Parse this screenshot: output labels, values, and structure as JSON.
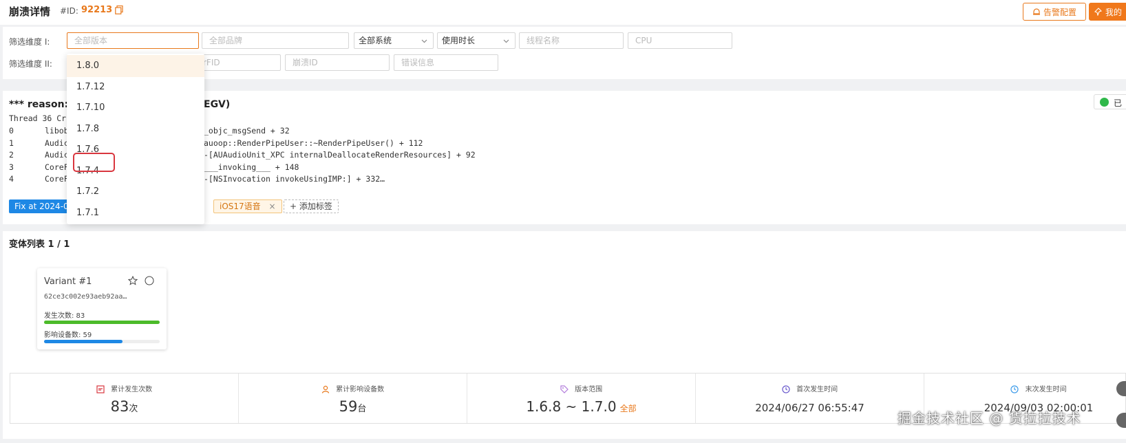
{
  "header": {
    "title": "崩溃详情",
    "id_label": "#ID:",
    "id_value": "92213",
    "alert_button": "告警配置",
    "mine_button": "我的"
  },
  "filters": {
    "row1_label": "筛选维度 I:",
    "row2_label": "筛选维度 II:",
    "version_placeholder": "全部版本",
    "brand_placeholder": "全部品牌",
    "system_value": "全部系统",
    "duration_value": "使用时长",
    "thread_placeholder": "线程名称",
    "cpu_placeholder": "CPU",
    "userfid_placeholder": "rFID",
    "crash_id_placeholder": "崩溃ID",
    "error_placeholder": "错误信息"
  },
  "version_dropdown": {
    "options": [
      "1.8.0",
      "1.7.12",
      "1.7.10",
      "1.7.8",
      "1.7.6",
      "1.7.4",
      "1.7.2",
      "1.7.1"
    ]
  },
  "reason": {
    "title": "*** reason:",
    "title_tail": "EGV)",
    "status_label": "已",
    "thread_header": "Thread 36 Cr",
    "frames": [
      {
        "idx": "0",
        "lib": "libob",
        "symbol": "_objc_msgSend + 32"
      },
      {
        "idx": "1",
        "lib": "Audic",
        "symbol": "auoop::RenderPipeUser::~RenderPipeUser() + 112"
      },
      {
        "idx": "2",
        "lib": "Audic",
        "symbol": "-[AUAudioUnit_XPC internalDeallocateRenderResources] + 92"
      },
      {
        "idx": "3",
        "lib": "CoreF",
        "symbol": "___invoking___ + 148"
      },
      {
        "idx": "4",
        "lib": "CoreF",
        "symbol": "-[NSInvocation invokeUsingIMP:] + 332…"
      }
    ],
    "tags": {
      "fix": "Fix at 2024-0",
      "ios": "iOS17语音",
      "add": "添加标签"
    }
  },
  "variants": {
    "title": "变体列表 1 / 1",
    "cards": [
      {
        "name": "Variant #1",
        "hash": "62ce3c002e93aeb92aa…",
        "occurrences_label": "发生次数: 83",
        "devices_label": "影响设备数: 59",
        "occurrences_fill": 1.0,
        "devices_fill": 0.68
      }
    ]
  },
  "stats": {
    "total_count_label": "累计发生次数",
    "total_count_value": "83",
    "total_count_unit": "次",
    "devices_label": "累计影响设备数",
    "devices_value": "59",
    "devices_unit": "台",
    "version_label": "版本范围",
    "version_value": "1.6.8 ~ 1.7.0",
    "version_all": "全部",
    "first_label": "首次发生时间",
    "first_value": "2024/06/27 06:55:47",
    "last_label": "末次发生时间",
    "last_value": "2024/09/03 02:00:01"
  },
  "watermark": "掘金技术社区 @ 货拉拉技术",
  "colors": {
    "accent": "#e8781b",
    "blue": "#1e88e5",
    "green": "#4cbb2a",
    "highlight": "#d9363e"
  }
}
